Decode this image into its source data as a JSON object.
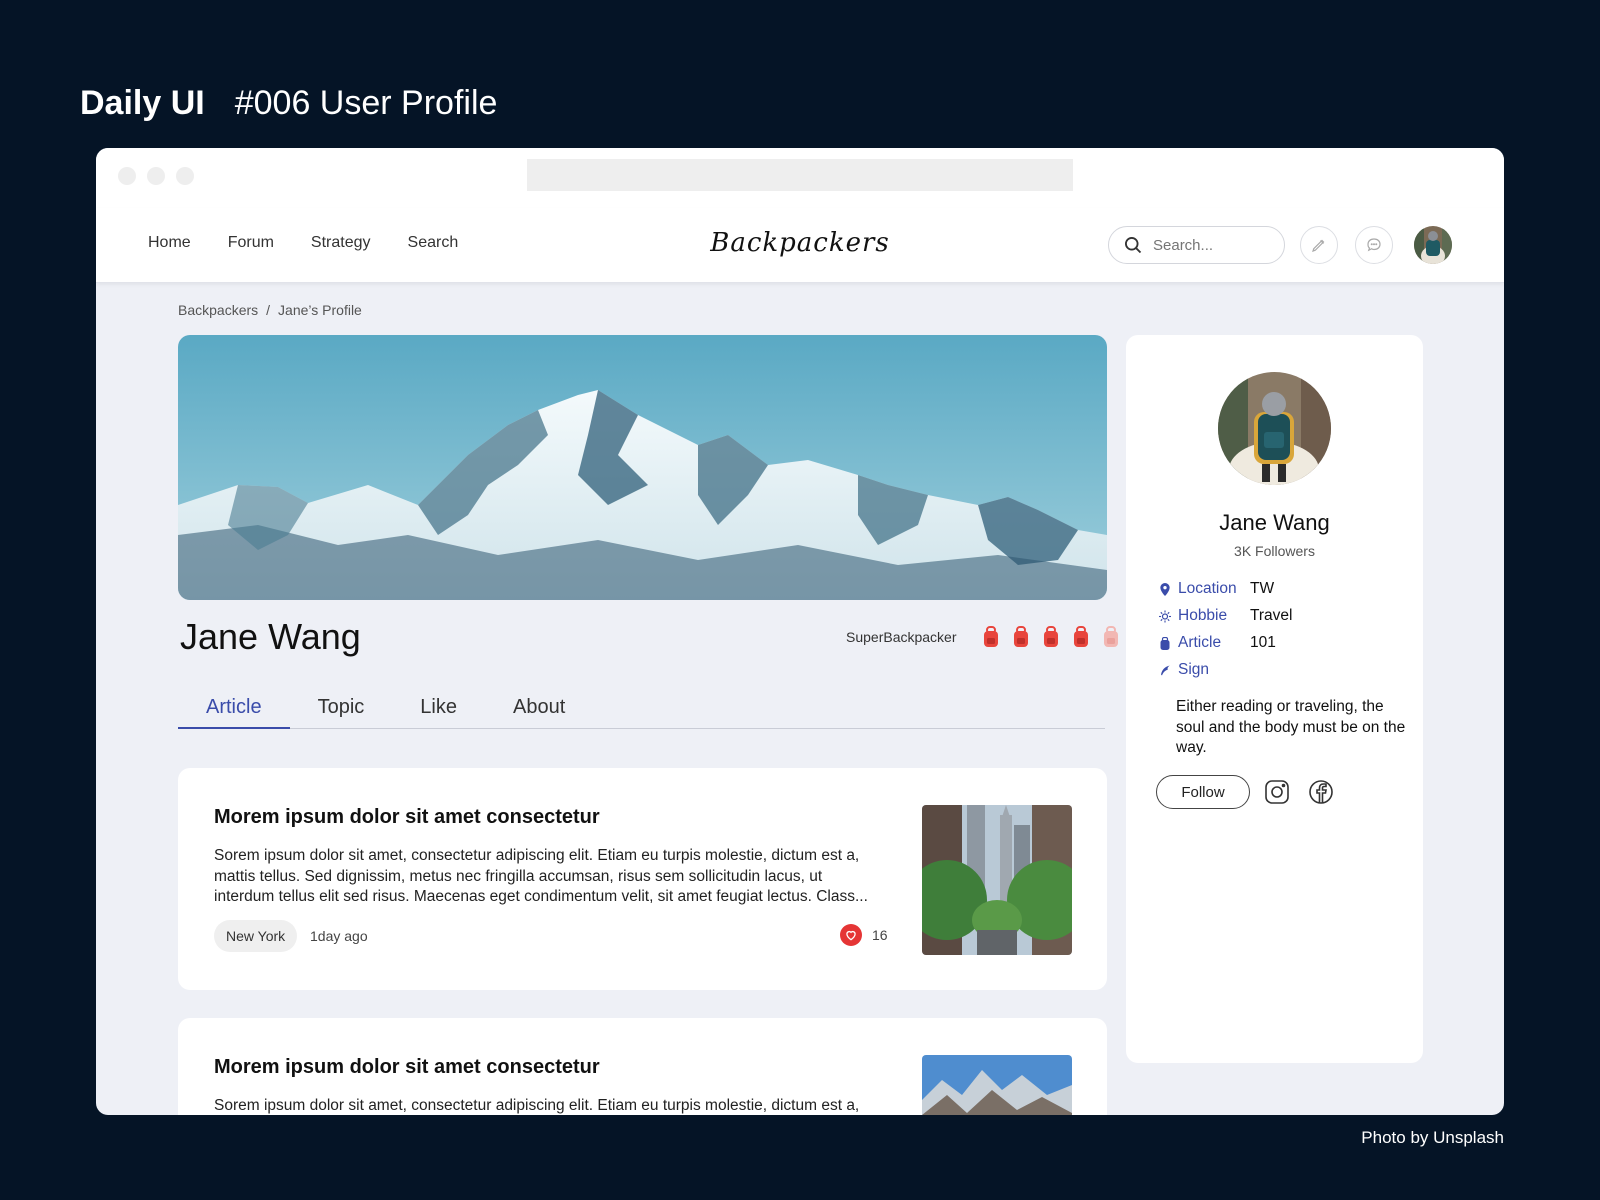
{
  "heading": {
    "brand": "Daily UI",
    "title": "#006  User Profile"
  },
  "credit": "Photo by Unsplash",
  "nav": {
    "links": [
      "Home",
      "Forum",
      "Strategy",
      "Search"
    ],
    "logo": "Backpackers",
    "search_placeholder": "Search...",
    "icons": [
      "search-icon",
      "pen-icon",
      "chat-icon"
    ]
  },
  "breadcrumb": {
    "root": "Backpackers",
    "separator": "/",
    "current": "Jane’s Profile"
  },
  "profile": {
    "name": "Jane Wang",
    "rank_label": "SuperBackpacker",
    "rank_level": 4,
    "rank_max": 5
  },
  "tabs": [
    "Article",
    "Topic",
    "Like",
    "About"
  ],
  "active_tab": "Article",
  "articles": [
    {
      "title": "Morem ipsum dolor sit amet consectetur",
      "text": "Sorem ipsum dolor sit amet, consectetur adipiscing elit. Etiam eu turpis molestie, dictum est a, mattis tellus. Sed dignissim, metus nec fringilla accumsan, risus sem sollicitudin lacus, ut interdum tellus elit sed risus. Maecenas eget condimentum velit, sit amet feugiat lectus. Class...",
      "tag": "New York",
      "time": "1day ago",
      "likes": "16"
    },
    {
      "title": "Morem ipsum dolor sit amet consectetur",
      "text": "Sorem ipsum dolor sit amet, consectetur adipiscing elit. Etiam eu turpis molestie, dictum est a,"
    }
  ],
  "sidebar": {
    "name": "Jane Wang",
    "followers": "3K Followers",
    "info": [
      {
        "key": "Location",
        "value": "TW",
        "icon": "location-pin-icon"
      },
      {
        "key": "Hobbie",
        "value": "Travel",
        "icon": "sun-icon"
      },
      {
        "key": "Article",
        "value": "101",
        "icon": "backpack-icon"
      },
      {
        "key": "Sign",
        "value": "",
        "icon": "quill-icon"
      }
    ],
    "sign_text": "Either reading or traveling, the soul and the body must be on the way.",
    "follow_label": "Follow",
    "social": [
      "instagram-icon",
      "facebook-icon"
    ]
  },
  "colors": {
    "accent": "#3a4caa",
    "background": "#051426",
    "page": "#eef0f6",
    "like": "#e53535",
    "badge": "#e8453c"
  }
}
